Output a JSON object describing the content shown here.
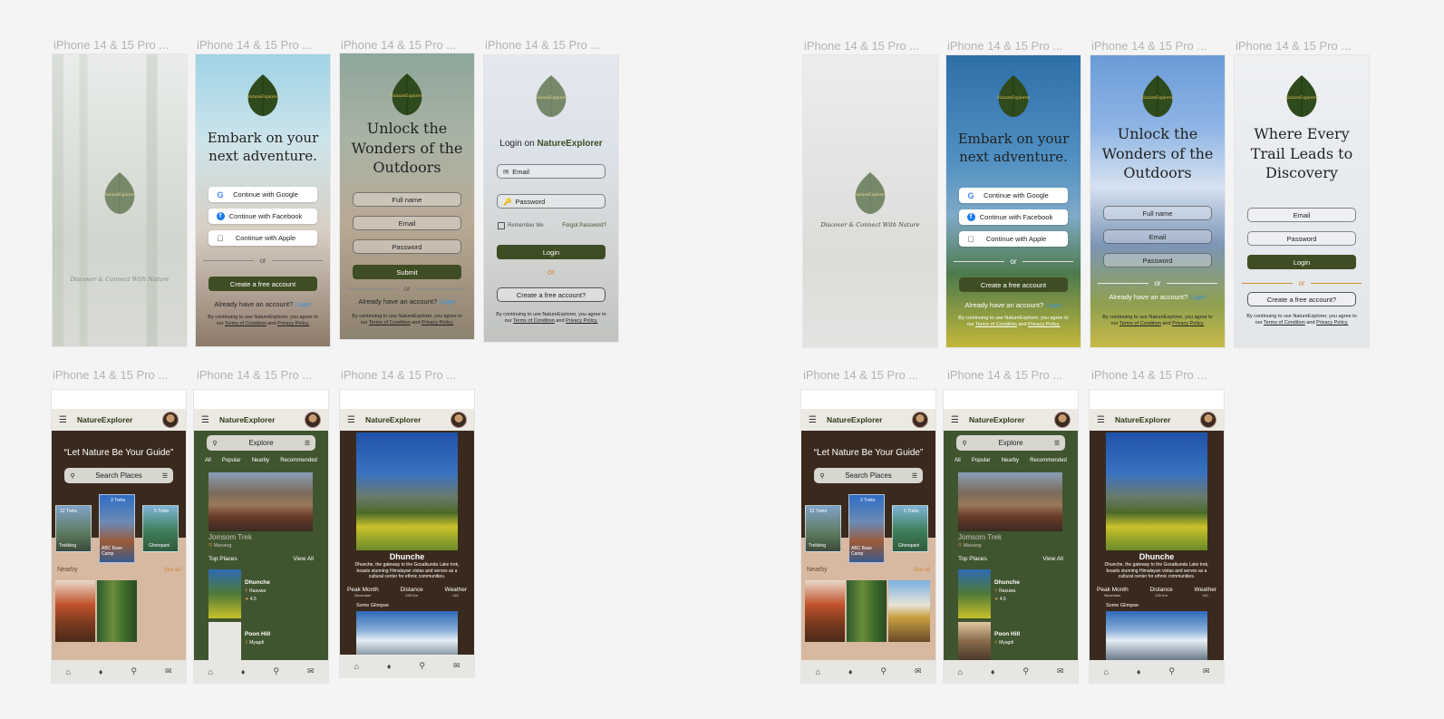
{
  "frame_title": "iPhone 14 & 15 Pro ...",
  "brand": "NatureExplorer",
  "logo_text": "NatureExplorer",
  "tagline": "Discover & Connect With Nature",
  "headline_embark": "Embark on your next adventure.",
  "headline_unlock": "Unlock the Wonders of the Outdoors",
  "headline_trail": "Where Every Trail Leads to Discovery",
  "login_title_prefix": "Login on ",
  "login_title_brand": "NatureExplorer",
  "social": {
    "google": "Continue with Google",
    "facebook": "Continue with Facebook",
    "apple": "Continue with Apple"
  },
  "or": "or",
  "create_account": "Create a free account",
  "create_account_q": "Create a free account?",
  "already_prefix": "Already have an account? ",
  "login_link": "Login",
  "login_button": "Login",
  "submit": "Submit",
  "fields": {
    "full_name": "Full name",
    "email": "Email",
    "password": "Password"
  },
  "remember_me": "Remember Me",
  "forgot_password": "Forgot Password?",
  "legal_line1": "By continuing to use NatureExplorer, you agree to",
  "legal_our": "our ",
  "legal_terms": "Terms of Condition",
  "legal_and": " and ",
  "legal_privacy": "Privacy Policy.",
  "home": {
    "quote": "“Let Nature Be Your Guide”",
    "search": "Search Places",
    "nearby": "Nearby",
    "see_all": "See all",
    "cards": [
      {
        "days": "12 Treks",
        "name": "Trekking"
      },
      {
        "days": "3 Treks",
        "name": "ABC Base Camp"
      },
      {
        "days": "5 Treks",
        "name": "Ghorepani"
      }
    ]
  },
  "explore": {
    "search": "Explore",
    "chips": [
      "All",
      "Popular",
      "Nearby",
      "Recommended"
    ],
    "featured_title": "Jomsom Trek",
    "featured_loc": "Manang",
    "top_places": "Top Places",
    "view_all": "View All",
    "places": [
      {
        "name": "Dhunche",
        "loc": "Rasuwa",
        "rating": "4.5"
      },
      {
        "name": "Poon Hill",
        "loc": "Myagdi"
      }
    ]
  },
  "detail": {
    "title": "Dhunche",
    "desc": "Dhunche, the gateway to the Gosaikunda Lake trek, boasts stunning Himalayan vistas and serves as a cultural center for ethnic communities.",
    "stats": [
      {
        "label": "Peak Month",
        "value": "November"
      },
      {
        "label": "Distance",
        "value": "225 Km"
      },
      {
        "label": "Weather",
        "value": "14C"
      }
    ],
    "glimpse": "Some Glimpse"
  },
  "colors": {
    "primary": "#3f4d24",
    "brown": "#3a2a1d",
    "green": "#3f5530",
    "link": "#3b8fd6",
    "accent_orange": "#d0893a"
  },
  "icons": {
    "home": "home-icon",
    "bell": "bell-icon",
    "search": "search-icon",
    "mail": "mail-icon",
    "menu": "menu-icon"
  }
}
